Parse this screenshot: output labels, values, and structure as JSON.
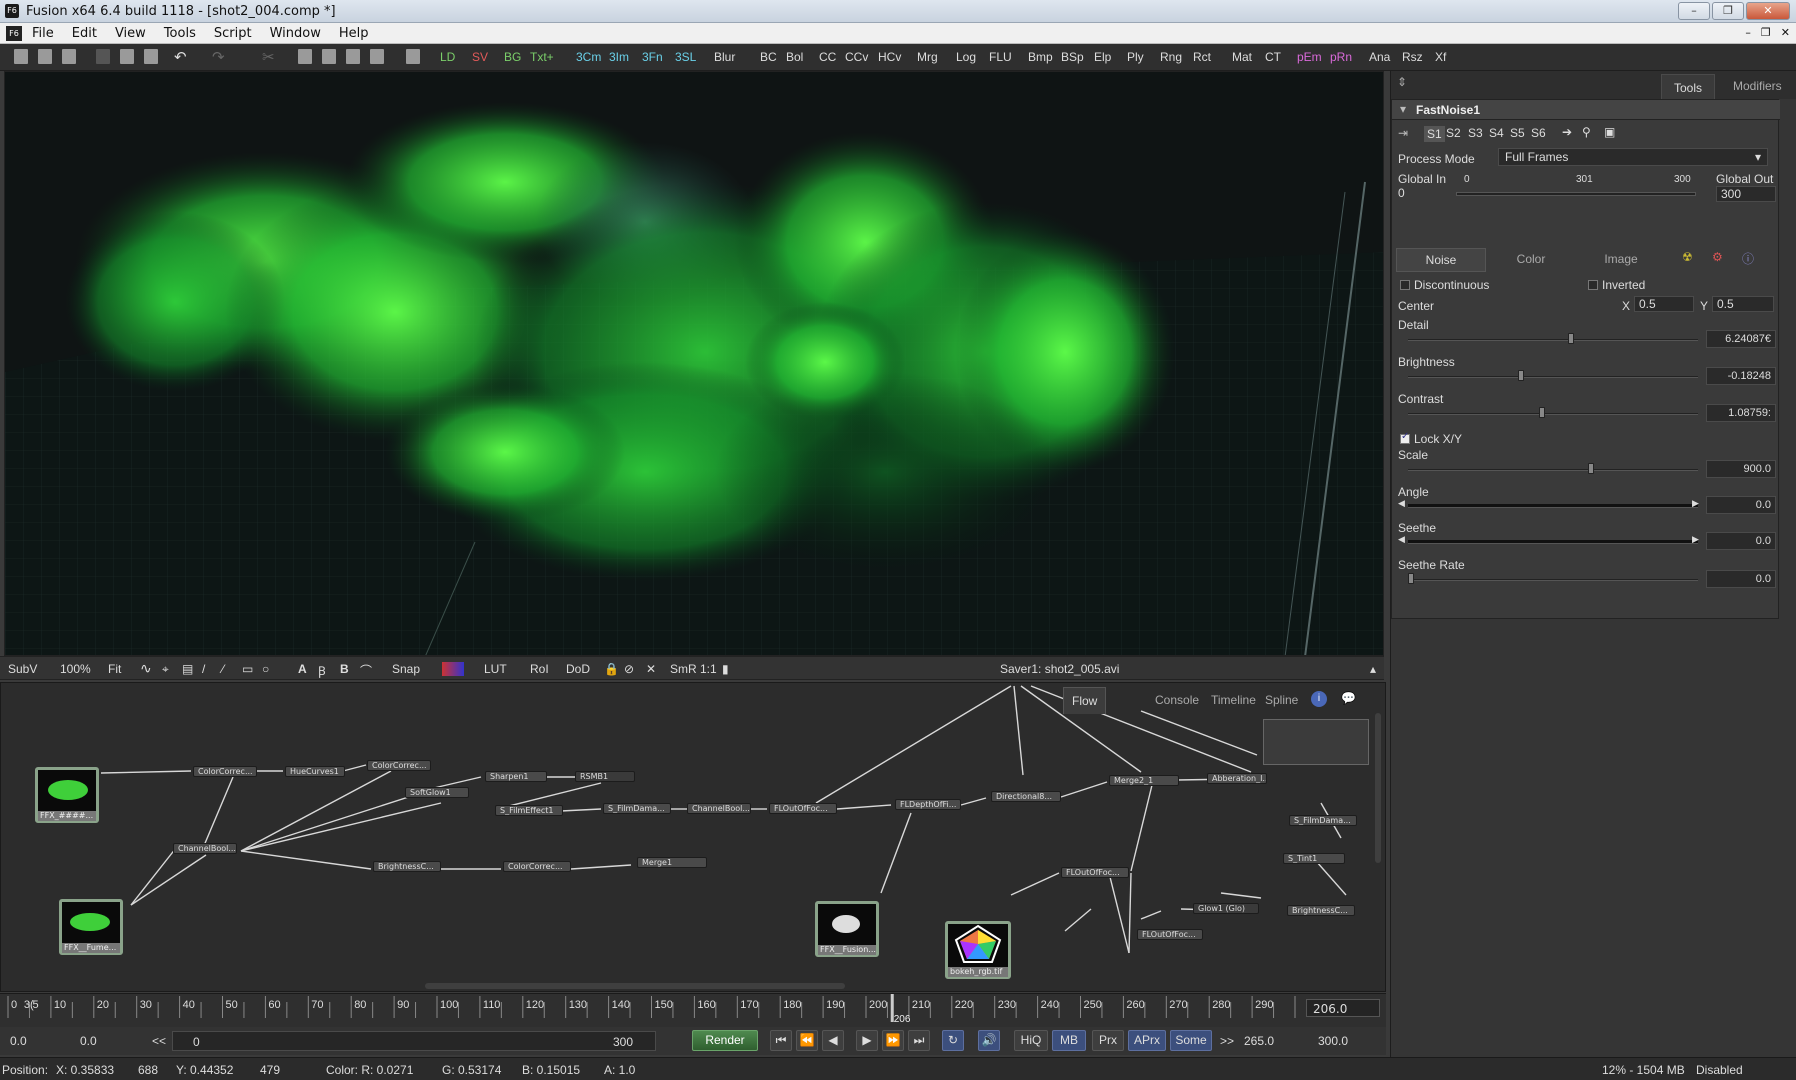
{
  "window": {
    "title": "Fusion x64 6.4 build 1118 - [shot2_004.comp *]",
    "app_icon": "F6"
  },
  "menu": {
    "items": [
      "File",
      "Edit",
      "View",
      "Tools",
      "Script",
      "Window",
      "Help"
    ]
  },
  "toolbar": {
    "tools": [
      "LD",
      "SV",
      "BG",
      "Txt+",
      "3Cm",
      "3Im",
      "3Fn",
      "3SL",
      "Blur",
      "BC",
      "Bol",
      "CC",
      "CCv",
      "HCv",
      "Mrg",
      "Log",
      "FLU",
      "Bmp",
      "BSp",
      "Elp",
      "Ply",
      "Rng",
      "Rct",
      "Mat",
      "CT",
      "pEm",
      "pRn",
      "Ana",
      "Rsz",
      "Xf"
    ]
  },
  "viewer_bar": {
    "subview": "SubV",
    "zoom": "100%",
    "fit": "Fit",
    "snap": "Snap",
    "lut": "LUT",
    "roi": "RoI",
    "dod": "DoD",
    "smr": "SmR",
    "ratio": "1:1",
    "saver_label": "Saver1: shot2_005.avi"
  },
  "flow": {
    "tabs": [
      "Flow",
      "Console",
      "Timeline",
      "Spline"
    ],
    "nodes": [
      "ColorCorrec...",
      "HueCurves1",
      "ColorCorrec...",
      "SoftGlow1",
      "Sharpen1",
      "RSMB1",
      "S_FilmEffect1",
      "S_FilmDama...",
      "ChannelBool...",
      "FLOutOfFoc...",
      "FLDepthOfFi...",
      "Directional8...",
      "Merge2_1",
      "Abberation_I...",
      "S_FilmDama...",
      "S_Tint1",
      "ChannelBool...",
      "BrightnessC...",
      "ColorCorrec...",
      "Merge1",
      "FLOutOfFoc...",
      "Glow1 (Glo)",
      "BrightnessC...",
      "FLOutOfFoc..."
    ],
    "thumbs": [
      "FFX_####...",
      "FFX__Fume...",
      "FFX__Fusion...",
      "bokeh_rgb.tif"
    ]
  },
  "timeline": {
    "ticks": [
      "0",
      "5",
      "10",
      "20",
      "30",
      "40",
      "50",
      "60",
      "70",
      "80",
      "90",
      "100",
      "110",
      "120",
      "130",
      "140",
      "150",
      "160",
      "170",
      "180",
      "190",
      "200",
      "210",
      "220",
      "230",
      "240",
      "250",
      "260",
      "270",
      "280",
      "290",
      "3("
    ],
    "current": "206",
    "current_field": "206.0"
  },
  "transport": {
    "start": "0.0",
    "global_start": "0.0",
    "range_start": "0",
    "range_end": "300",
    "render": "Render",
    "hiq": "HiQ",
    "mb": "MB",
    "prx": "Prx",
    "aprx": "APrx",
    "some": "Some",
    "render_end": "265.0",
    "global_end": "300.0",
    "prev_arrow": "<<",
    "next_arrow": ">>"
  },
  "status": {
    "position_label": "Position:",
    "x": "X: 0.35833",
    "px": "688",
    "y": "Y: 0.44352",
    "py": "479",
    "color_r": "Color: R: 0.0271",
    "color_g": "G: 0.53174",
    "color_b": "B: 0.15015",
    "alpha": "A: 1.0",
    "memory": "12% - 1504 MB",
    "disabled": "Disabled"
  },
  "panel": {
    "tabs": [
      "Tools",
      "Modifiers"
    ],
    "tool_name": "FastNoise1",
    "scripts": [
      "S1",
      "S2",
      "S3",
      "S4",
      "S5",
      "S6"
    ],
    "process_mode_label": "Process Mode",
    "process_mode_value": "Full Frames",
    "global_in_label": "Global In",
    "global_in_value": "0",
    "global_out_label": "Global Out",
    "global_out_value": "300",
    "range_left": "0",
    "range_mid": "301",
    "range_right": "300",
    "subtabs": [
      "Noise",
      "Color",
      "Image"
    ],
    "discontinuous": "Discontinuous",
    "inverted": "Inverted",
    "center_label": "Center",
    "center_x_label": "X",
    "center_x": "0.5",
    "center_y_label": "Y",
    "center_y": "0.5",
    "detail_label": "Detail",
    "detail": "6.24087€",
    "brightness_label": "Brightness",
    "brightness": "-0.18248",
    "contrast_label": "Contrast",
    "contrast": "1.08759:",
    "lockxy_label": "Lock X/Y",
    "scale_label": "Scale",
    "scale": "900.0",
    "angle_label": "Angle",
    "angle": "0.0",
    "seethe_label": "Seethe",
    "seethe": "0.0",
    "seethe_rate_label": "Seethe Rate",
    "seethe_rate": "0.0"
  }
}
